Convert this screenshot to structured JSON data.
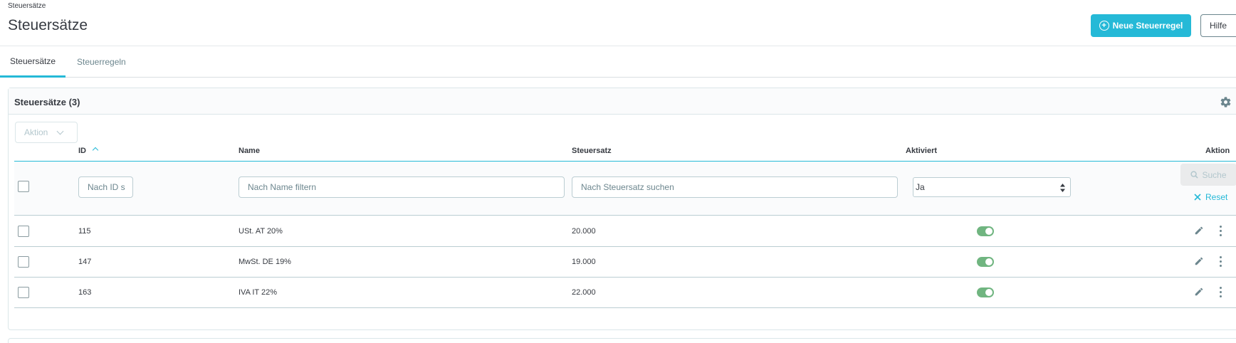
{
  "header": {
    "breadcrumb": "Steuersätze",
    "title": "Steuersätze",
    "new_button_label": "Neue Steuerregel",
    "help_button_label": "Hilfe"
  },
  "tabs": [
    {
      "label": "Steuersätze",
      "active": true
    },
    {
      "label": "Steuerregeln",
      "active": false
    }
  ],
  "grid": {
    "title": "Steuersätze (3)",
    "bulk_action_label": "Aktion",
    "columns": {
      "id": "ID",
      "name": "Name",
      "rate": "Steuersatz",
      "enabled": "Aktiviert",
      "actions": "Aktion"
    },
    "filters": {
      "id_placeholder": "Nach ID s",
      "name_placeholder": "Nach Name filtern",
      "rate_placeholder": "Nach Steuersatz suchen",
      "enabled_value": "Ja",
      "search_label": "Suche",
      "reset_label": "Reset"
    },
    "rows": [
      {
        "id": "115",
        "name": "USt. AT 20%",
        "rate": "20.000",
        "enabled": true
      },
      {
        "id": "147",
        "name": "MwSt. DE 19%",
        "rate": "19.000",
        "enabled": true
      },
      {
        "id": "163",
        "name": "IVA IT 22%",
        "rate": "22.000",
        "enabled": true
      }
    ]
  },
  "colors": {
    "accent": "#25b9d7",
    "toggle_on": "#70b580"
  },
  "icons": {
    "new_button": "plus-circle-icon",
    "settings": "gear-icon",
    "sort": "caret-up-icon",
    "search": "search-icon",
    "reset": "close-icon",
    "edit": "pencil-icon",
    "more": "kebab-icon"
  }
}
